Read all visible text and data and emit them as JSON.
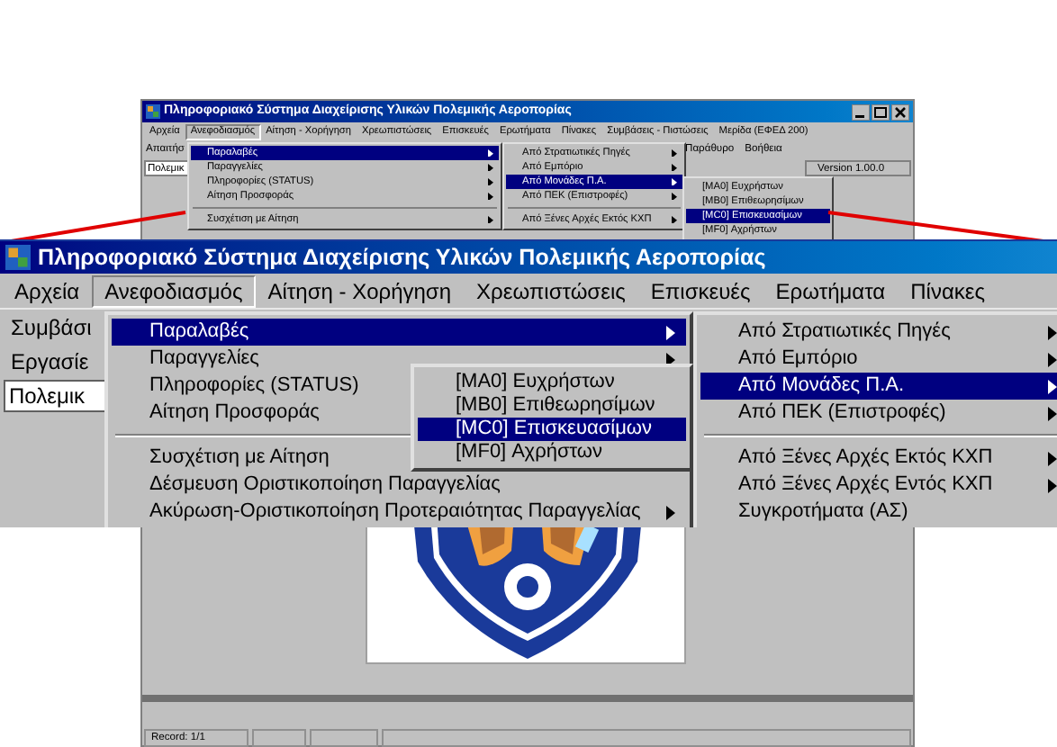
{
  "small_window": {
    "title": "Πληροφοριακό Σύστημα Διαχείρισης Υλικών Πολεμικής Αεροπορίας",
    "menu": [
      {
        "label": "Αρχεία",
        "selected": false
      },
      {
        "label": "Ανεφοδιασμός",
        "selected": true
      },
      {
        "label": "Αίτηση - Χορήγηση",
        "selected": false
      },
      {
        "label": "Χρεωπιστώσεις",
        "selected": false
      },
      {
        "label": "Επισκευές",
        "selected": false
      },
      {
        "label": "Ερωτήματα",
        "selected": false
      },
      {
        "label": "Πίνακες",
        "selected": false
      },
      {
        "label": "Συμβάσεις - Πιστώσεις",
        "selected": false
      },
      {
        "label": "Μερίδα (ΕΦΕΔ 200)",
        "selected": false
      }
    ],
    "second_row": {
      "left": "Απαιτήσ",
      "right": [
        "Παράθυρο",
        "Βοήθεια"
      ]
    },
    "field": "Πολεμικ",
    "version": "Version 1.00.0",
    "dropdown": [
      {
        "label": "Παραλαβές",
        "selected": true,
        "has_submenu": true,
        "separator_before": false
      },
      {
        "label": "Παραγγελίες",
        "selected": false,
        "has_submenu": true,
        "separator_before": false
      },
      {
        "label": "Πληροφορίες (STATUS)",
        "selected": false,
        "has_submenu": true,
        "separator_before": false
      },
      {
        "label": "Αίτηση Προσφοράς",
        "selected": false,
        "has_submenu": true,
        "separator_before": false
      },
      {
        "label": "Συσχέτιση με Αίτηση",
        "selected": false,
        "has_submenu": true,
        "separator_before": true
      }
    ],
    "submenu": [
      {
        "label": "Από Στρατιωτικές Πηγές",
        "selected": false,
        "has_submenu": true,
        "separator_before": false
      },
      {
        "label": "Από Εμπόριο",
        "selected": false,
        "has_submenu": true,
        "separator_before": false
      },
      {
        "label": "Από Μονάδες Π.Α.",
        "selected": true,
        "has_submenu": true,
        "separator_before": false
      },
      {
        "label": "Από ΠΕΚ (Επιστροφές)",
        "selected": false,
        "has_submenu": true,
        "separator_before": false
      },
      {
        "label": "Από Ξένες Αρχές Εκτός ΚΧΠ",
        "selected": false,
        "has_submenu": true,
        "separator_before": true
      }
    ],
    "subsubmenu": [
      {
        "label": "[MA0] Ευχρήστων",
        "selected": false,
        "has_submenu": false
      },
      {
        "label": "[MB0] Επιθεωρησίμων",
        "selected": false,
        "has_submenu": false
      },
      {
        "label": "[MC0] Επισκευασίμων",
        "selected": true,
        "has_submenu": false
      },
      {
        "label": "[MF0] Αχρήστων",
        "selected": false,
        "has_submenu": false
      }
    ],
    "status_bar": [
      "Record: 1/1"
    ]
  },
  "magnified": {
    "title": "Πληροφοριακό Σύστημα Διαχείρισης Υλικών Πολεμικής Αεροπορίας",
    "menu": [
      {
        "label": "Αρχεία",
        "selected": false
      },
      {
        "label": "Ανεφοδιασμός",
        "selected": true
      },
      {
        "label": "Αίτηση - Χορήγηση",
        "selected": false
      },
      {
        "label": "Χρεωπιστώσεις",
        "selected": false
      },
      {
        "label": "Επισκευές",
        "selected": false
      },
      {
        "label": "Ερωτήματα",
        "selected": false
      },
      {
        "label": "Πίνακες",
        "selected": false
      }
    ],
    "rows": [
      "Συμβάσι",
      "Εργασίε"
    ],
    "field": "Πολεμικ",
    "dropdown": [
      {
        "label": "Παραλαβές",
        "selected": true,
        "has_submenu": true,
        "separator_before": false
      },
      {
        "label": "Παραγγελίες",
        "selected": false,
        "has_submenu": true,
        "separator_before": false
      },
      {
        "label": "Πληροφορίες (STATUS)",
        "selected": false,
        "separator_before": false
      },
      {
        "label": "Αίτηση Προσφοράς",
        "selected": false,
        "separator_before": false
      },
      {
        "label": "Συσχέτιση με Αίτηση",
        "selected": false,
        "has_submenu": false,
        "separator_before": true
      },
      {
        "label": "Δέσμευση Οριστικοποίηση Παραγγελίας",
        "selected": false,
        "has_submenu": false,
        "separator_before": false
      },
      {
        "label": "Ακύρωση-Οριστικοποίηση Προτεραιότητας Παραγγελίας",
        "selected": false,
        "has_submenu": true,
        "separator_before": false
      }
    ],
    "submenu": [
      {
        "label": "Από Στρατιωτικές Πηγές",
        "selected": false,
        "has_submenu": true,
        "separator_before": false
      },
      {
        "label": "Από Εμπόριο",
        "selected": false,
        "has_submenu": true,
        "separator_before": false
      },
      {
        "label": "Από Μονάδες Π.Α.",
        "selected": true,
        "has_submenu": true,
        "separator_before": false
      },
      {
        "label": "Από ΠΕΚ (Επιστροφές)",
        "selected": false,
        "has_submenu": true,
        "separator_before": false
      },
      {
        "label": "Από Ξένες Αρχές Εκτός ΚΧΠ",
        "selected": false,
        "has_submenu": true,
        "separator_before": true
      },
      {
        "label": "Από Ξένες Αρχές Εντός ΚΧΠ",
        "selected": false,
        "has_submenu": true,
        "separator_before": false
      },
      {
        "label": "Συγκροτήματα (ΑΣ)",
        "selected": false,
        "has_submenu": false,
        "separator_before": false
      }
    ],
    "subsubmenu": [
      {
        "label": "[MA0] Ευχρήστων",
        "selected": false,
        "has_submenu": false
      },
      {
        "label": "[MB0] Επιθεωρησίμων",
        "selected": false,
        "has_submenu": false
      },
      {
        "label": "[MC0] Επισκευασίμων",
        "selected": true,
        "has_submenu": false
      },
      {
        "label": "[MF0] Αχρήστων",
        "selected": false,
        "has_submenu": false
      }
    ]
  }
}
